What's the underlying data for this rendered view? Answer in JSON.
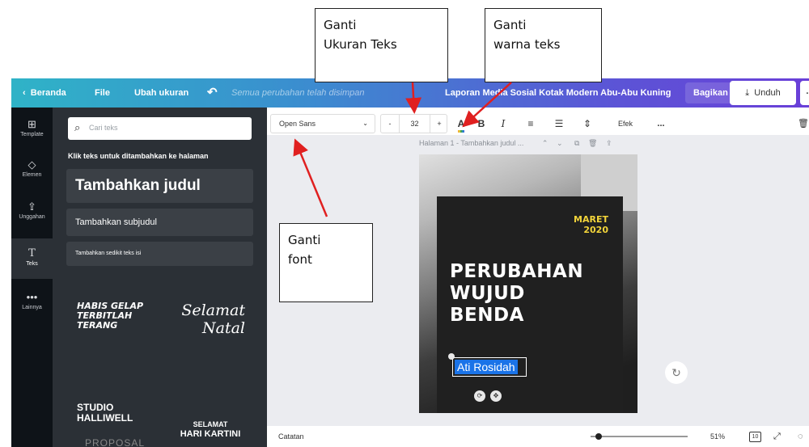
{
  "topbar": {
    "back_label": "Beranda",
    "file_label": "File",
    "resize_label": "Ubah ukuran",
    "undo_icon": "undo-icon",
    "saved_status": "Semua perubahan telah disimpan",
    "doc_title": "Laporan Media Sosial Kotak Modern Abu-Abu Kuning",
    "share_label": "Bagikan",
    "download_label": "Unduh",
    "more_label": "..."
  },
  "rail": {
    "items": [
      {
        "label": "Template",
        "icon": "template-icon"
      },
      {
        "label": "Elemen",
        "icon": "elements-icon"
      },
      {
        "label": "Unggahan",
        "icon": "upload-icon"
      },
      {
        "label": "Teks",
        "icon": "text-icon"
      },
      {
        "label": "Lainnya",
        "icon": "more-icon"
      }
    ]
  },
  "panel": {
    "search_placeholder": "Cari teks",
    "hint": "Klik teks untuk ditambahkan ke halaman",
    "heading_card": "Tambahkan judul",
    "subheading_card": "Tambahkan subjudul",
    "body_card": "Tambahkan sedikit teks isi",
    "templates": {
      "t1": "HABIS GELAP TERBITLAH TERANG",
      "t2_line1": "Selamat",
      "t2_line2": "Natal",
      "t3": "STUDIO HALLIWELL",
      "t4_line1": "SELAMAT",
      "t4_line2": "HARI KARTINI",
      "t5": "PROPOSAL"
    }
  },
  "toolbar": {
    "font_name": "Open Sans",
    "size_minus": "-",
    "font_size": "32",
    "size_plus": "+",
    "bold": "B",
    "italic": "I",
    "effects_label": "Efek",
    "more_label": "..."
  },
  "canvas": {
    "page_label": "Halaman 1 - Tambahkan judul ...",
    "design": {
      "month": "MARET",
      "year": "2020",
      "headline_1": "PERUBAHAN",
      "headline_2": "WUJUD",
      "headline_3": "BENDA",
      "author": "Ati Rosidah"
    }
  },
  "bottombar": {
    "notes_label": "Catatan",
    "zoom": "51%",
    "page_count": "10"
  },
  "callouts": {
    "size_line1": "Ganti",
    "size_line2": "Ukuran Teks",
    "color_line1": "Ganti",
    "color_line2": "warna teks",
    "font_line1": "Ganti",
    "font_line2": "font"
  },
  "colors": {
    "accent_start": "#2fb3c7",
    "accent_end": "#6a3fd8",
    "panel_bg": "#2b3036",
    "rail_bg": "#0e1318",
    "arrow": "#e02020",
    "design_yellow": "#f2d43a",
    "selection_blue": "#1a73e8"
  }
}
